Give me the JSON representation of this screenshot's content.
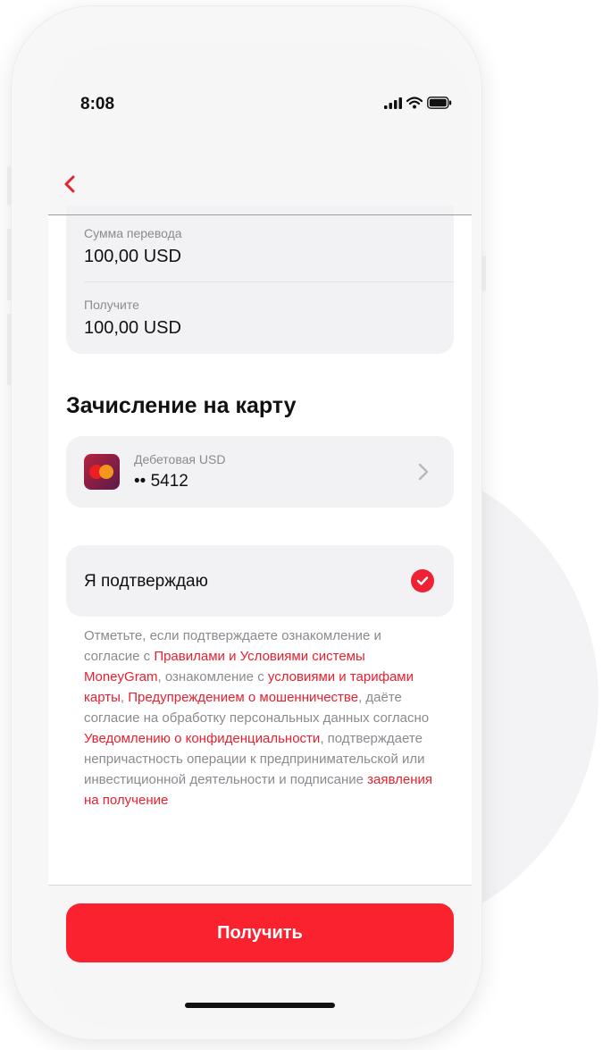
{
  "status_bar": {
    "time": "8:08",
    "icons": [
      "cellular-signal-icon",
      "wifi-icon",
      "battery-icon"
    ]
  },
  "nav": {
    "back_icon": "chevron-left-icon"
  },
  "summary": {
    "amount_label": "Сумма перевода",
    "amount_value": "100,00 USD",
    "receive_label": "Получите",
    "receive_value": "100,00 USD"
  },
  "crediting": {
    "title": "Зачисление на карту",
    "card_name": "Дебетовая USD",
    "card_number": "•• 5412",
    "card_logo": "mastercard-logo",
    "chevron_icon": "chevron-right-icon"
  },
  "confirmation": {
    "label": "Я подтверждаю",
    "checked": true
  },
  "legal": {
    "t1": "Отметьте, если подтверждаете ознакомление и согласие с ",
    "l1": "Правилами и Условиями системы MoneyGram",
    "t2": ", ознакомление с ",
    "l2": "условиями и тарифами карты",
    "t3": ", ",
    "l3": "Предупреждением о мошенничестве",
    "t4": ", даёте согласие на обработку персональных данных согласно ",
    "l4": "Уведомлению о конфиденциальности",
    "t5": ", подтверждаете непричастность операции к предпринимательской или инвестиционной деятельности и подписание ",
    "l5": "заявления на получение"
  },
  "action": {
    "label": "Получить"
  },
  "colors": {
    "accent": "#fb2230",
    "link": "#e8202f",
    "card_bg": "#f2f2f4"
  }
}
